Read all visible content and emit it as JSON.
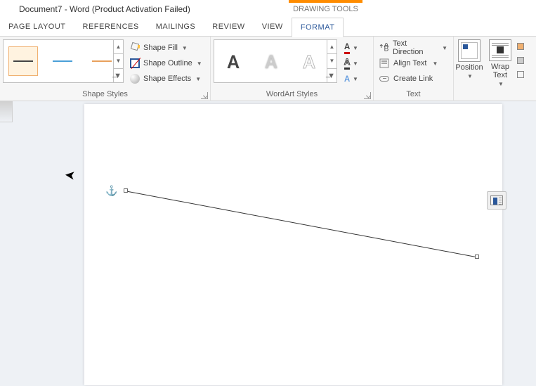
{
  "title": "Document7 - Word (Product Activation Failed)",
  "drawing_tools": "DRAWING TOOLS",
  "tabs": {
    "page_layout": "PAGE LAYOUT",
    "references": "REFERENCES",
    "mailings": "MAILINGS",
    "review": "REVIEW",
    "view": "VIEW",
    "format": "FORMAT"
  },
  "shape_styles": {
    "label": "Shape Styles",
    "fill": "Shape Fill",
    "outline": "Shape Outline",
    "effects": "Shape Effects"
  },
  "wordart": {
    "label": "WordArt Styles"
  },
  "text": {
    "label": "Text",
    "direction": "Text Direction",
    "align": "Align Text",
    "link": "Create Link"
  },
  "arrange": {
    "position": "Position",
    "wrap": "Wrap Text"
  },
  "colors": {
    "swatch1": "#444444",
    "swatch2": "#4a9fd8",
    "swatch3": "#e8a05c"
  }
}
